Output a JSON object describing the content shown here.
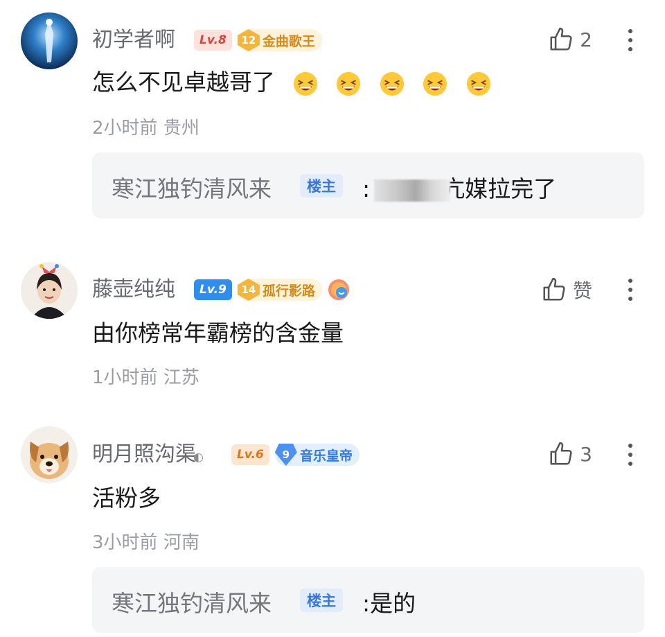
{
  "comments": [
    {
      "username": "初学者啊",
      "level": "Lv.8",
      "medal_num": "12",
      "medal_name": "金曲歌王",
      "like_count": "2",
      "text": "怎么不见卓越哥了",
      "emoji_count": 5,
      "time": "2小时前",
      "location": "贵州",
      "reply": {
        "name": "寒江独钓清风来",
        "tag": "楼主",
        "colon": ":",
        "text": "媒拉完了",
        "partial_char": "亢",
        "blurred": true
      }
    },
    {
      "username": "藤壶纯纯",
      "level": "Lv.9",
      "medal_num": "14",
      "medal_name": "孤行影路",
      "like_label": "赞",
      "text": "由你榜常年霸榜的含金量",
      "time": "1小时前",
      "location": "江苏"
    },
    {
      "username": "明月照沟渠",
      "level": "Lv.6",
      "medal_num": "9",
      "medal_name": "音乐皇帝",
      "like_count": "3",
      "text": "活粉多",
      "time": "3小时前",
      "location": "河南",
      "reply": {
        "name": "寒江独钓清风来",
        "tag": "楼主",
        "colon": ":",
        "text": "是的"
      }
    }
  ],
  "colors": {
    "host_tag": "#3877d8",
    "lv9_badge": "#2f8df0",
    "gold_medal": "#d38a1b",
    "blue_medal": "#2f7be0"
  }
}
